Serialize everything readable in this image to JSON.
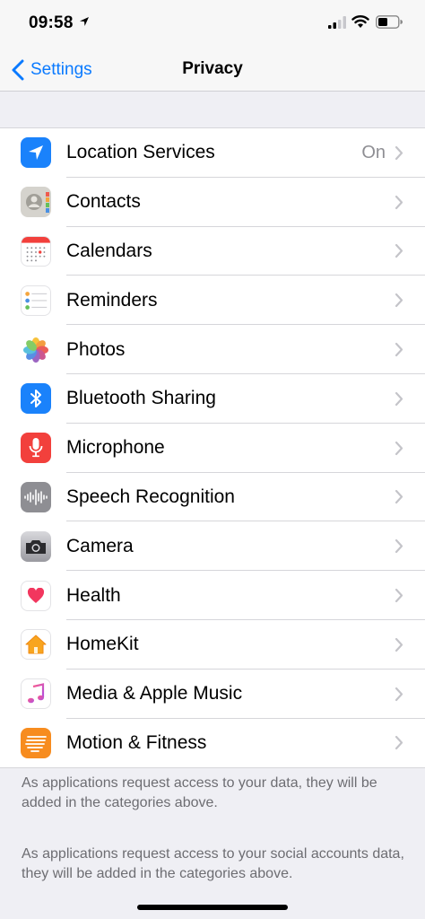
{
  "status_bar": {
    "time": "09:58"
  },
  "nav": {
    "back_label": "Settings",
    "title": "Privacy"
  },
  "items": [
    {
      "label": "Location Services",
      "value": "On",
      "icon": "location-arrow-icon",
      "color": "#1a82fb"
    },
    {
      "label": "Contacts",
      "value": "",
      "icon": "contacts-icon",
      "color": "#d5d3cd"
    },
    {
      "label": "Calendars",
      "value": "",
      "icon": "calendar-icon",
      "color": "#ffffff"
    },
    {
      "label": "Reminders",
      "value": "",
      "icon": "reminders-icon",
      "color": "#ffffff"
    },
    {
      "label": "Photos",
      "value": "",
      "icon": "photos-icon",
      "color": "#ffffff"
    },
    {
      "label": "Bluetooth Sharing",
      "value": "",
      "icon": "bluetooth-icon",
      "color": "#1a82fb"
    },
    {
      "label": "Microphone",
      "value": "",
      "icon": "microphone-icon",
      "color": "#f2403c"
    },
    {
      "label": "Speech Recognition",
      "value": "",
      "icon": "speech-waveform-icon",
      "color": "#8e8e93"
    },
    {
      "label": "Camera",
      "value": "",
      "icon": "camera-icon",
      "color": "#5b5b60"
    },
    {
      "label": "Health",
      "value": "",
      "icon": "heart-icon",
      "color": "#ffffff"
    },
    {
      "label": "HomeKit",
      "value": "",
      "icon": "home-icon",
      "color": "#ffffff"
    },
    {
      "label": "Media & Apple Music",
      "value": "",
      "icon": "music-note-icon",
      "color": "#ffffff"
    },
    {
      "label": "Motion & Fitness",
      "value": "",
      "icon": "motion-fitness-icon",
      "color": "#f78c1f"
    }
  ],
  "footer": {
    "note1": "As applications request access to your data, they will be added in the categories above.",
    "note2": "As applications request access to your social accounts data, they will be added in the categories above."
  },
  "colors": {
    "accent": "#0a7aff",
    "background": "#efeff4"
  }
}
